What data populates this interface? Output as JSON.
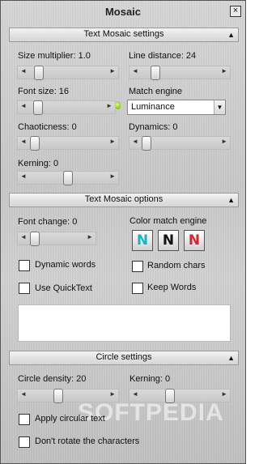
{
  "title": "Mosaic",
  "close_glyph": "×",
  "sections": {
    "s1": "Text Mosaic settings",
    "s2": "Text Mosaic options",
    "s3": "Circle settings",
    "collapse_glyph": "▲"
  },
  "settings": {
    "size_multiplier": {
      "label": "Size multiplier: 1.0",
      "value": 1.0
    },
    "line_distance": {
      "label": "Line distance: 24",
      "value": 24
    },
    "font_size": {
      "label": "Font size: 16",
      "value": 16
    },
    "match_engine": {
      "label": "Match engine",
      "selected": "Luminance"
    },
    "chaoticness": {
      "label": "Chaoticness: 0",
      "value": 0
    },
    "dynamics": {
      "label": "Dynamics: 0",
      "value": 0
    },
    "kerning": {
      "label": "Kerning: 0",
      "value": 0
    }
  },
  "options": {
    "font_change": {
      "label": "Font change: 0",
      "value": 0
    },
    "color_match_engine": {
      "label": "Color match engine",
      "buttons": [
        "N",
        "N",
        "N"
      ]
    },
    "dynamic_words": "Dynamic words",
    "random_chars": "Random chars",
    "use_quicktext": "Use QuickText",
    "keep_words": "Keep Words"
  },
  "circle": {
    "density": {
      "label": "Circle density: 20",
      "value": 20
    },
    "kerning": {
      "label": "Kerning: 0",
      "value": 0
    },
    "apply_circular": "Apply circular text",
    "dont_rotate": "Don't rotate the characters"
  },
  "arrows": {
    "left": "◄",
    "right": "►",
    "down": "▼"
  },
  "watermark": "SOFTPEDIA",
  "colors": {
    "btn1": "#19b3c4",
    "btn2": "#111111",
    "btn3": "#d9232d"
  }
}
